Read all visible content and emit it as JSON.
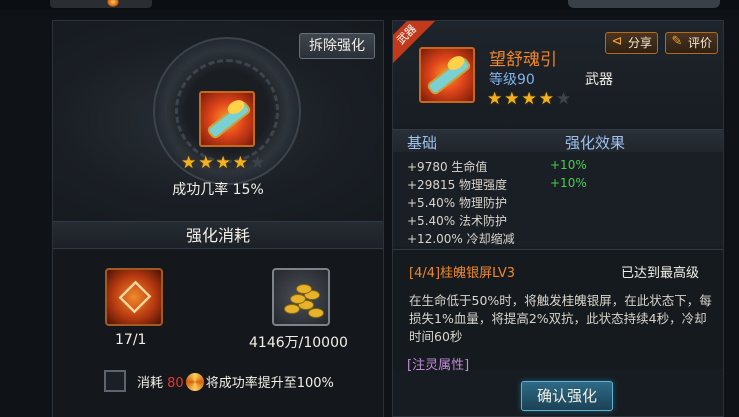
{
  "left": {
    "remove_button": "拆除强化",
    "rating_stars": {
      "filled": 4,
      "total": 5
    },
    "success_rate": "成功几率 15%",
    "cost_header": "强化消耗",
    "materials": [
      {
        "icon": "enhance-stone-icon",
        "count": "17/1"
      },
      {
        "icon": "gold-coins-icon",
        "count": "4146万/10000"
      }
    ],
    "consume": {
      "prefix": "消耗",
      "amount": "80",
      "suffix": "将成功率提升至100%"
    }
  },
  "right": {
    "corner_tag": "武器",
    "item_name": "望舒魂引",
    "item_level": "等级90",
    "item_type": "武器",
    "share_button": "分享",
    "review_button": "评价",
    "rating_stars": {
      "filled": 4,
      "total": 5
    },
    "stats_header": {
      "base": "基础",
      "effect": "强化效果"
    },
    "stats": [
      {
        "text": "+9780 生命值",
        "bonus": "+10%"
      },
      {
        "text": "+29815 物理强度",
        "bonus": "+10%"
      },
      {
        "text": "+5.40% 物理防护",
        "bonus": ""
      },
      {
        "text": "+5.40% 法术防护",
        "bonus": ""
      },
      {
        "text": "+12.00% 冷却缩减",
        "bonus": ""
      }
    ],
    "skill_title": "[4/4]桂魄银屏LV3",
    "skill_status": "已达到最高级",
    "skill_desc": "在生命低于50%时，将触发桂魄银屏，在此状态下，每损失1%血量，将提高2%双抗，此状态持续4秒，冷却时间60秒",
    "spirit_attr": "[注灵属性]",
    "confirm_button": "确认强化"
  },
  "colors": {
    "accent_orange": "#f0872a",
    "bonus_green": "#3fd24a",
    "level_blue": "#7fb3ea",
    "red": "#e8362a"
  }
}
